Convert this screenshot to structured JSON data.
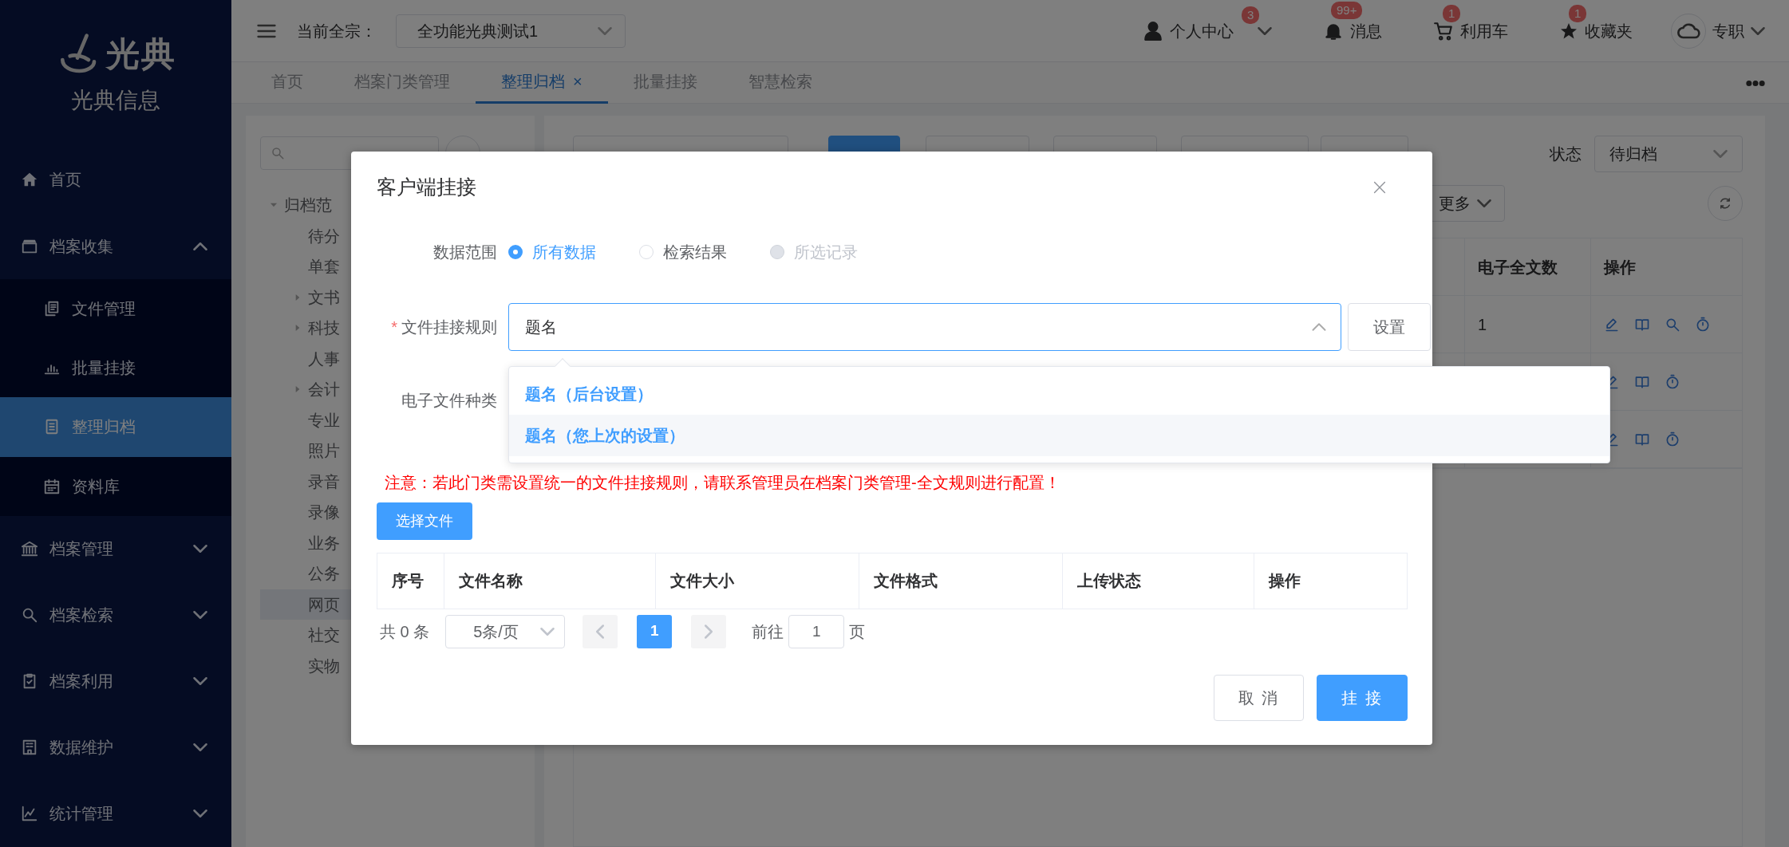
{
  "sidebar": {
    "logo": "光典",
    "org": "光典信息",
    "menu": [
      {
        "label": "首页",
        "kind": "link",
        "selected": false
      },
      {
        "label": "档案收集",
        "kind": "group",
        "selected": false,
        "expanded": true,
        "children": [
          {
            "label": "文件管理",
            "selected": false
          },
          {
            "label": "批量挂接",
            "selected": false
          },
          {
            "label": "整理归档",
            "selected": true
          },
          {
            "label": "资料库",
            "selected": false
          }
        ]
      },
      {
        "label": "档案管理",
        "kind": "group",
        "selected": false,
        "expanded": false
      },
      {
        "label": "档案检索",
        "kind": "group",
        "selected": false,
        "expanded": false
      },
      {
        "label": "档案利用",
        "kind": "group",
        "selected": false,
        "expanded": false
      },
      {
        "label": "数据维护",
        "kind": "group",
        "selected": false,
        "expanded": false
      },
      {
        "label": "统计管理",
        "kind": "group",
        "selected": false,
        "expanded": false
      }
    ]
  },
  "topbar": {
    "fonds_label": "当前全宗：",
    "fonds_select": "全功能光典测试1",
    "actions": [
      {
        "label": "个人中心",
        "badge": "3",
        "kind": "user"
      },
      {
        "label": "消息",
        "badge": "99+",
        "kind": "bell"
      },
      {
        "label": "利用车",
        "badge": "1",
        "kind": "cart"
      },
      {
        "label": "收藏夹",
        "badge": "1",
        "kind": "star"
      }
    ],
    "account": "专职"
  },
  "tabs": [
    {
      "label": "首页",
      "selected": false
    },
    {
      "label": "档案门类管理",
      "selected": false
    },
    {
      "label": "整理归档",
      "selected": true,
      "close": "×"
    },
    {
      "label": "批量挂接",
      "selected": false
    },
    {
      "label": "智慧检索",
      "selected": false
    }
  ],
  "tree": {
    "items": [
      {
        "label": "归档范",
        "kind": "branch",
        "expanded": true,
        "selected": false,
        "children": [
          {
            "label": "待分",
            "kind": "leaf",
            "selected": false
          },
          {
            "label": "单套",
            "kind": "leaf",
            "selected": false
          },
          {
            "label": "文书",
            "kind": "branch",
            "expanded": false,
            "selected": false
          },
          {
            "label": "科技",
            "kind": "branch",
            "expanded": false,
            "selected": false
          },
          {
            "label": "人事",
            "kind": "leaf",
            "selected": false
          },
          {
            "label": "会计",
            "kind": "branch",
            "expanded": false,
            "selected": false
          },
          {
            "label": "专业",
            "kind": "leaf",
            "selected": false
          },
          {
            "label": "照片",
            "kind": "leaf",
            "selected": false
          },
          {
            "label": "录音",
            "kind": "leaf",
            "selected": false
          },
          {
            "label": "录像",
            "kind": "leaf",
            "selected": false
          },
          {
            "label": "业务",
            "kind": "leaf",
            "selected": false
          },
          {
            "label": "公务",
            "kind": "leaf",
            "selected": false
          },
          {
            "label": "网页",
            "kind": "leaf",
            "selected": true
          },
          {
            "label": "社交",
            "kind": "leaf",
            "selected": false
          },
          {
            "label": "实物",
            "kind": "leaf",
            "selected": false
          }
        ]
      }
    ]
  },
  "main": {
    "status_label": "状态",
    "status_select": "待归档",
    "more_button": "更多",
    "table": {
      "columns": [
        "电子全文数",
        "操作"
      ],
      "rows": [
        {
          "count": "1",
          "view_action": true
        },
        {
          "view_action": false
        },
        {
          "view_action": false
        }
      ]
    }
  },
  "modal": {
    "title": "客户端挂接",
    "scope": {
      "label": "数据范围",
      "options": [
        {
          "label": "所有数据",
          "selected": true,
          "disabled": false
        },
        {
          "label": "检索结果",
          "selected": false,
          "disabled": false
        },
        {
          "label": "所选记录",
          "selected": false,
          "disabled": true
        }
      ]
    },
    "rule": {
      "required_mark": "*",
      "label": "文件挂接规则",
      "value": "题名",
      "expanded": true,
      "button": "设置",
      "options": [
        {
          "label": "题名（后台设置）",
          "highlighted": false
        },
        {
          "label": "题名（您上次的设置）",
          "highlighted": true
        }
      ]
    },
    "file_type": {
      "label": "电子文件种类"
    },
    "notice": "注意：若此门类需设置统一的文件挂接规则，请联系管理员在档案门类管理-全文规则进行配置！",
    "choose_button": "选择文件",
    "table": {
      "columns": [
        "序号",
        "文件名称",
        "文件大小",
        "文件格式",
        "上传状态",
        "操作"
      ]
    },
    "pagination": {
      "total": "共 0 条",
      "page_size": "5条/页",
      "pages": [
        {
          "label": "1",
          "selected": true
        }
      ],
      "goto_label": "前往",
      "goto_value": "1",
      "goto_suffix": "页"
    },
    "buttons": [
      {
        "label": "取 消",
        "kind": "default"
      },
      {
        "label": "挂 接",
        "kind": "primary"
      }
    ]
  }
}
